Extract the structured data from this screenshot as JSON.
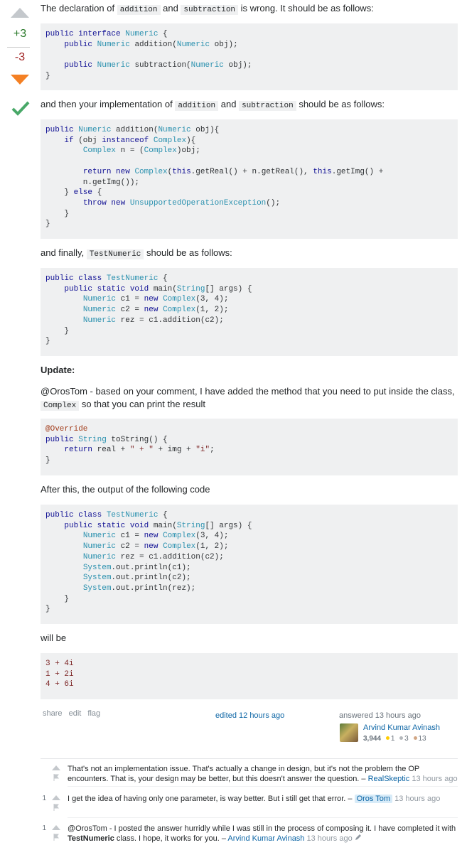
{
  "votes": {
    "up": "+3",
    "down": "-3"
  },
  "p1": {
    "a": "The declaration of ",
    "c1": "addition",
    "b": " and ",
    "c2": "subtraction",
    "d": " is wrong. It should be as follows:"
  },
  "p2": {
    "a": "and then your implementation of ",
    "c1": "addition",
    "b": " and ",
    "c2": "subtraction",
    "d": " should be as follows:"
  },
  "p3": {
    "a": "and finally, ",
    "c1": "TestNumeric",
    "d": " should be as follows:"
  },
  "update": "Update:",
  "p4": {
    "a": "@OrosTom - based on your comment, I have added the method that you need to put inside the class, ",
    "c1": "Complex",
    "d": " so that you can print the result"
  },
  "p5": "After this, the output of the following code",
  "p6": "will be",
  "menu": {
    "share": "share",
    "edit": "edit",
    "flag": "flag"
  },
  "edited": "edited 12 hours ago",
  "answered": "answered 13 hours ago",
  "author": {
    "name": "Arvind Kumar Avinash",
    "rep": "3,944",
    "gold": "1",
    "silver": "3",
    "bronze": "13"
  },
  "comments": [
    {
      "score": "",
      "text": "That's not an implementation issue. That's actually a change in design, but it's not the problem the OP encounters. That is, your design may be better, but this doesn't answer the question. – ",
      "user": "RealSkeptic",
      "time": "13 hours ago"
    },
    {
      "score": "1",
      "text": "I get the idea of having only one parameter, is way better. But i still get that error. – ",
      "user": "Oros Tom",
      "time": "13 hours ago"
    },
    {
      "score": "1",
      "text_a": "@OrosTom - I posted the answer hurridly while I was still in the process of composing it. I have completed it with ",
      "bold": "TestNumeric",
      "text_b": " class. I hope, it works for you. – ",
      "user": "Arvind Kumar Avinash",
      "time": "13 hours ago"
    }
  ],
  "output_lines": [
    "3 + 4i",
    "1 + 2i",
    "4 + 6i"
  ]
}
